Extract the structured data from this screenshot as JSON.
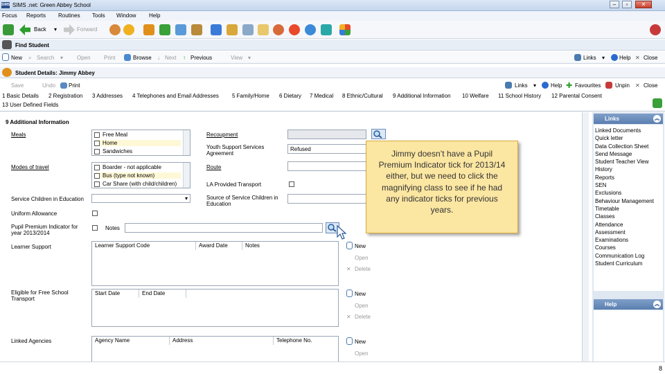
{
  "window": {
    "title": "SIMS .net: Green Abbey School",
    "logo_text": "SIMS"
  },
  "menu": [
    "Focus",
    "Reports",
    "Routines",
    "Tools",
    "Window",
    "Help"
  ],
  "nav": {
    "back": "Back",
    "forward": "Forward"
  },
  "find_student": {
    "title": "Find Student"
  },
  "find_toolbar": {
    "new": "New",
    "search": "Search",
    "open": "Open",
    "print": "Print",
    "browse": "Browse",
    "next": "Next",
    "previous": "Previous",
    "view": "View",
    "links": "Links",
    "help": "Help",
    "close": "Close"
  },
  "student_details": {
    "title": "Student Details: Jimmy Abbey"
  },
  "sd_toolbar": {
    "save": "Save",
    "undo": "Undo",
    "print": "Print",
    "links": "Links",
    "help": "Help",
    "favourites": "Favourites",
    "unpin": "Unpin",
    "close": "Close"
  },
  "tabs": [
    "1 Basic Details",
    "2 Registration",
    "3 Addresses",
    "4 Telephones and Email Addresses",
    "5 Family/Home",
    "6 Dietary",
    "7 Medical",
    "8 Ethnic/Cultural",
    "9 Additional Information",
    "10 Welfare",
    "11 School History",
    "12 Parental Consent",
    "13 User Defined Fields"
  ],
  "section": {
    "title": "9 Additional Information"
  },
  "form": {
    "meals_label": "Meals",
    "meals_options": [
      "Free Meal",
      "Home",
      "Sandwiches"
    ],
    "modes_label": "Modes of travel",
    "modes_options": [
      "Boarder - not applicable",
      "Bus (type not known)",
      "Car Share (with child/children)"
    ],
    "service_children_label": "Service Children in Education",
    "uniform_label": "Uniform Allowance",
    "ppi_label": "Pupil Premium Indicator for year 2013/2014",
    "notes_label": "Notes",
    "recoupment_label": "Recoupment",
    "ysa_label": "Youth Support Services Agreement",
    "ysa_value": "Refused",
    "route_label": "Route",
    "la_transport_label": "LA Provided Transport",
    "source_service_label": "Source of Service Children in Education",
    "learner_support_label": "Learner Support",
    "learner_support_cols": [
      "Learner Support Code",
      "Award Date",
      "Notes"
    ],
    "fsm_label": "Eligible for Free School Transport",
    "fsm_cols": [
      "Start Date",
      "End Date"
    ],
    "agencies_label": "Linked Agencies",
    "agencies_cols": [
      "Agency Name",
      "Address",
      "Telephone No."
    ],
    "new": "New",
    "open": "Open",
    "delete": "Delete"
  },
  "links_panel": {
    "title": "Links",
    "items": [
      "Linked Documents",
      "Quick letter",
      "Data Collection Sheet",
      "Send Message",
      "Student Teacher View",
      "History",
      "Reports",
      "SEN",
      "Exclusions",
      "Behaviour Management",
      "Timetable",
      "Classes",
      "Attendance",
      "Assessment",
      "Examinations",
      "Courses",
      "Communication Log",
      "Student Curriculum"
    ]
  },
  "help_panel": {
    "title": "Help"
  },
  "callout": {
    "text": "Jimmy doesn’t have a Pupil Premium Indicator tick for 2013/14 either, but we need to click the magnifying class to see if he had any indicator ticks for previous years."
  },
  "slide_number": "8",
  "colors": {
    "accent": "#5a7fb0",
    "callout_bg": "#fbe6a2",
    "callout_border": "#d9a93a"
  }
}
